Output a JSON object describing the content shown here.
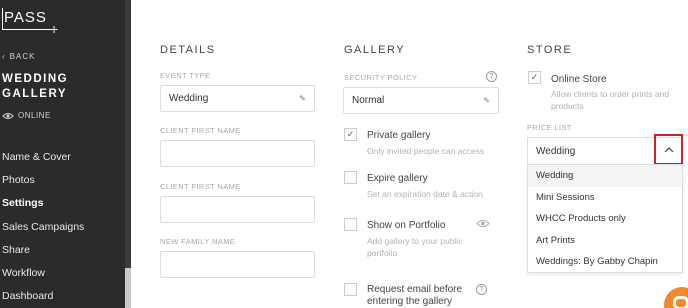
{
  "sidebar": {
    "logo_text": "PASS",
    "back_label": "BACK",
    "gallery_title": "WEDDING GALLERY",
    "status": "ONLINE",
    "nav": [
      {
        "label": "Name & Cover"
      },
      {
        "label": "Photos"
      },
      {
        "label": "Settings",
        "active": true
      },
      {
        "label": "Sales Campaigns"
      },
      {
        "label": "Share"
      },
      {
        "label": "Workflow"
      },
      {
        "label": "Dashboard"
      }
    ]
  },
  "details": {
    "title": "DETAILS",
    "event_type_label": "EVENT TYPE",
    "event_type_value": "Wedding",
    "client_first_name_label": "CLIENT FIRST NAME",
    "client_first_name_value": "",
    "client_first_name_2_label": "CLIENT FIRST NAME",
    "client_first_name_2_value": "",
    "new_family_name_label": "NEW FAMILY NAME",
    "new_family_name_value": ""
  },
  "gallery": {
    "title": "GALLERY",
    "security_policy_label": "SECURITY POLICY",
    "security_policy_value": "Normal",
    "private": {
      "title": "Private gallery",
      "desc": "Only invited people can access",
      "checked": true
    },
    "expire": {
      "title": "Expire gallery",
      "desc": "Set an expiration date & action",
      "checked": false
    },
    "portfolio": {
      "title": "Show on Portfolio",
      "desc_line1": "Add gallery to your public",
      "desc_line2": "portfolio",
      "checked": false
    },
    "request_email": {
      "title_line1": "Request email before",
      "title_line2": "entering the gallery",
      "checked": false
    }
  },
  "store": {
    "title": "STORE",
    "online_store": {
      "title": "Online Store",
      "desc_line1": "Allow clients to order prints and",
      "desc_line2": "products",
      "checked": true
    },
    "price_list_label": "PRICE LIST",
    "price_list_value": "Wedding",
    "options": [
      "Wedding",
      "Mini Sessions",
      "WHCC Products only",
      "Art Prints",
      "Weddings: By Gabby Chapin"
    ]
  },
  "colors": {
    "sidebar_bg": "#2b2b2b",
    "highlight": "#d0202a",
    "chat": "#f08a2c"
  }
}
